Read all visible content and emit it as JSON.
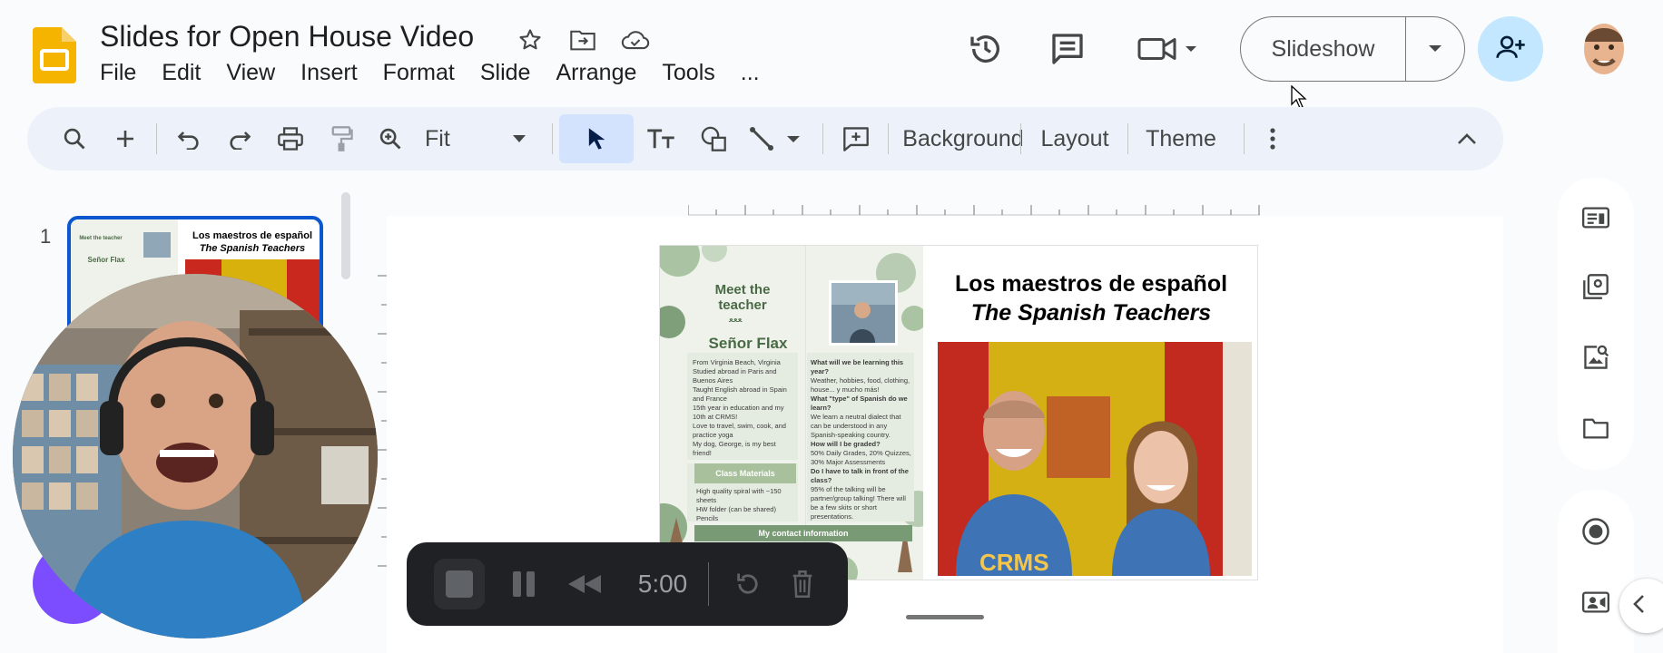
{
  "header": {
    "doc_title": "Slides for Open House Video",
    "menu": [
      "File",
      "Edit",
      "View",
      "Insert",
      "Format",
      "Slide",
      "Arrange",
      "Tools",
      "..."
    ],
    "slideshow_label": "Slideshow"
  },
  "toolbar": {
    "zoom_value": "Fit",
    "background_label": "Background",
    "layout_label": "Layout",
    "theme_label": "Theme"
  },
  "filmstrip": {
    "slide_number": "1",
    "thumb_title_1": "Los maestros de español",
    "thumb_title_2": "The Spanish Teachers",
    "thumb_meet": "Meet the teacher",
    "thumb_name": "Señor Flax"
  },
  "slide": {
    "title_line_1": "Los maestros de español",
    "title_line_2": "The Spanish Teachers",
    "meet_label": "Meet the teacher",
    "divider_1": "ﻌﻌﻌ",
    "teacher_name": "Señor Flax",
    "bio_items": [
      "From Virginia Beach, Virginia",
      "Studied abroad in Paris and Buenos Aires",
      "Taught English abroad in Spain and France",
      "15th year in education and my 10th at CRMS!",
      "Love to travel, swim, cook, and practice yoga",
      "My dog, George, is my best friend!"
    ],
    "class_materials_label": "Class Materials",
    "class_materials": [
      "High quality spiral with ~150 sheets",
      "HW folder (can be shared)",
      "Pencils"
    ],
    "faq": [
      "What will we be learning this year?",
      "Weather, hobbies, food, clothing, house... y mucho más!",
      "What \"type\" of Spanish do we learn?",
      "We learn a neutral dialect that can be understood in any Spanish-speaking country.",
      "How will I be graded?",
      "50% Daily Grades, 20% Quizzes, 30% Major Assessments",
      "Do I have to talk in front of the class?",
      "95% of the talking will be partner/group talking! There will be a few skits or short presentations."
    ],
    "contact_label": "My contact information"
  },
  "recorder": {
    "time": "5:00"
  },
  "colors": {
    "accent": "#0b57d0",
    "share_bg": "#c2e7ff",
    "toolbar_bg": "#edf2fa",
    "recorder_bg": "#202124"
  },
  "icons": [
    "slides-logo-icon",
    "star-icon",
    "move-folder-icon",
    "cloud-saved-icon",
    "history-icon",
    "comment-icon",
    "video-call-icon",
    "add-person-icon",
    "search-icon",
    "plus-icon",
    "undo-icon",
    "redo-icon",
    "print-icon",
    "paint-format-icon",
    "zoom-icon",
    "select-icon",
    "textbox-icon",
    "shape-icon",
    "line-icon",
    "new-slide-icon",
    "more-vert-icon",
    "chevron-up-icon",
    "speaker-notes-icon",
    "slide-panel-icon",
    "image-search-icon",
    "folder-icon",
    "record-icon",
    "camera-icon",
    "chevron-left-icon",
    "stop-icon",
    "pause-icon",
    "rewind-icon",
    "restart-icon",
    "trash-icon"
  ]
}
